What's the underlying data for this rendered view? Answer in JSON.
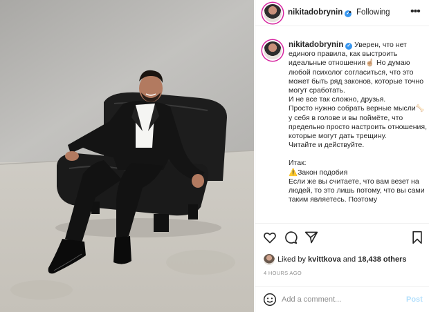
{
  "post": {
    "username": "nikitadobrynin",
    "verified_icon": "verified-badge-icon",
    "dot": "•",
    "follow_status": "Following",
    "more_icon": "more-options-icon"
  },
  "caption": {
    "username": "nikitadobrynin",
    "lines": [
      "Уверен, что нет единого правила, как выстроить идеальные отношения☝🏼 Но думаю любой психолог согласиться, что это может быть ряд законов, которые точно могут сработать.",
      "И не все так сложно, друзья.",
      "Просто нужно собрать верные мысли🦴 у себя в голове и вы поймёте, что предельно просто настроить отношения, которые могут дать трещину.",
      "Читайте и действуйте.",
      "",
      "Итак:",
      "⚠️Закон подобия",
      "Если же вы считаете, что вам везет на людей, то это лишь потому, что вы сами таким являетесь. Поэтому"
    ]
  },
  "actions": {
    "like_icon": "heart-icon",
    "comment_icon": "comment-icon",
    "share_icon": "share-icon",
    "save_icon": "bookmark-icon"
  },
  "likes": {
    "prefix": "Liked by ",
    "user": "kvittkova",
    "middle": " and ",
    "count": "18,438 others"
  },
  "timestamp": "4 HOURS AGO",
  "comment": {
    "placeholder": "Add a comment...",
    "post_label": "Post",
    "emoji_icon": "emoji-smiley-icon"
  },
  "colors": {
    "verified": "#3897f0",
    "post_button_disabled": "#b2dffc",
    "muted_text": "#8e8e8e",
    "story_ring": "#d6249f"
  }
}
